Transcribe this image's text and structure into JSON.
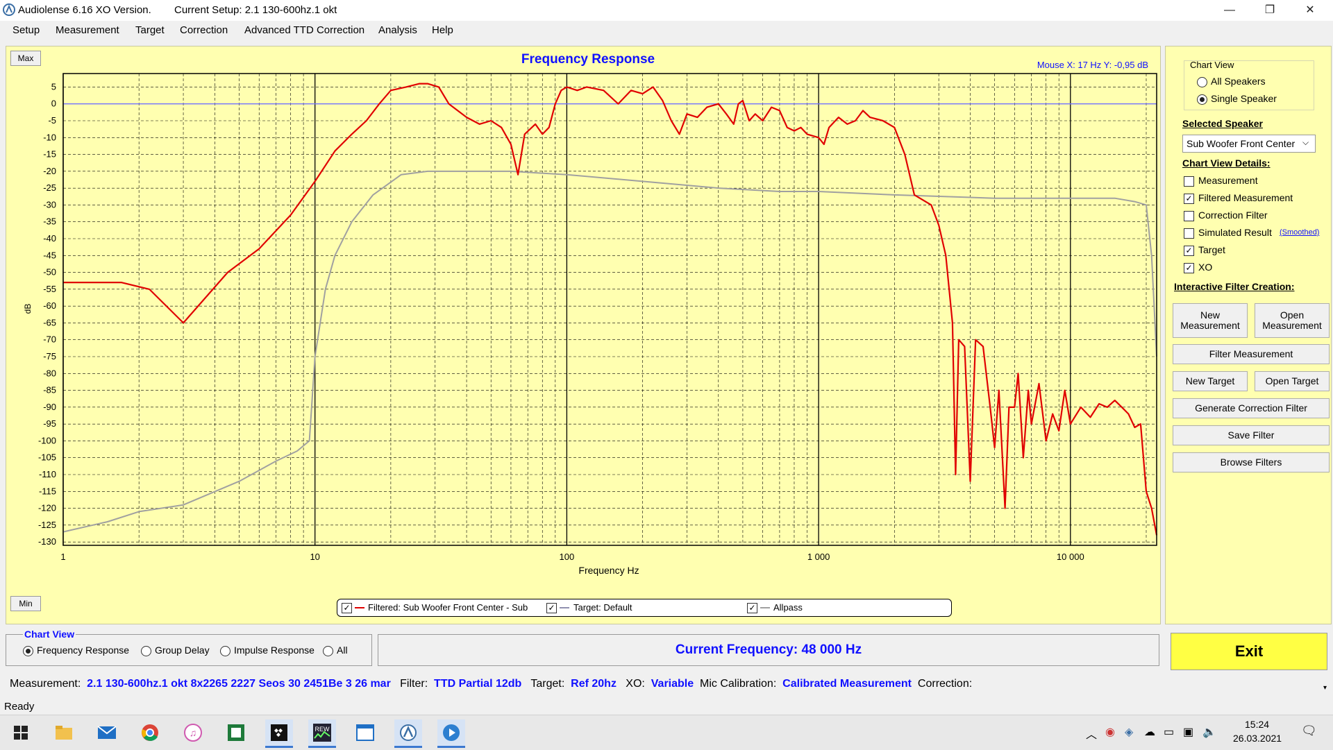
{
  "window": {
    "app_title": "Audiolense 6.16 XO Version.",
    "setup_title": "Current Setup: 2.1 130-600hz.1 okt",
    "minimize": "—",
    "maximize": "❐",
    "close": "✕"
  },
  "menu": [
    "Setup",
    "Measurement",
    "Target",
    "Correction",
    "Advanced TTD Correction",
    "Analysis",
    "Help"
  ],
  "chart": {
    "max_label": "Max",
    "min_label": "Min",
    "mouse_readout": "Mouse X: 17 Hz   Y: -0,95 dB",
    "legend": {
      "filtered": "Filtered: Sub Woofer Front Center - Sub",
      "target": "Target: Default",
      "allpass": "Allpass"
    }
  },
  "chart_data": {
    "type": "line",
    "title": "Frequency Response",
    "xlabel": "Frequency Hz",
    "ylabel": "dB",
    "xscale": "log",
    "xlim": [
      1,
      22000
    ],
    "ylim": [
      -131,
      9
    ],
    "xtick_labels": [
      {
        "x": 1,
        "label": "1"
      },
      {
        "x": 10,
        "label": "10"
      },
      {
        "x": 100,
        "label": "100"
      },
      {
        "x": 1000,
        "label": "1 000"
      },
      {
        "x": 10000,
        "label": "10 000"
      }
    ],
    "yticks": [
      5,
      0,
      -5,
      -10,
      -15,
      -20,
      -25,
      -30,
      -35,
      -40,
      -45,
      -50,
      -55,
      -60,
      -65,
      -70,
      -75,
      -80,
      -85,
      -90,
      -95,
      -100,
      -105,
      -110,
      -115,
      -120,
      -125,
      -130
    ],
    "grid": true,
    "colors": {
      "filtered": "#e00000",
      "target": "#7070ff",
      "allpass": "#a0a0a0",
      "background": "#ffffb0"
    },
    "series": [
      {
        "name": "Filtered: Sub Woofer Front Center - Sub",
        "points": [
          [
            1,
            -53
          ],
          [
            1.3,
            -53
          ],
          [
            1.7,
            -53
          ],
          [
            2.2,
            -55
          ],
          [
            3,
            -65
          ],
          [
            4.5,
            -50
          ],
          [
            6,
            -43
          ],
          [
            8,
            -33
          ],
          [
            10,
            -23
          ],
          [
            12,
            -14
          ],
          [
            14,
            -9
          ],
          [
            16,
            -5
          ],
          [
            18,
            0
          ],
          [
            20,
            4
          ],
          [
            23,
            5
          ],
          [
            26,
            6
          ],
          [
            28,
            6
          ],
          [
            31,
            5
          ],
          [
            34,
            0
          ],
          [
            40,
            -4
          ],
          [
            45,
            -6
          ],
          [
            50,
            -5
          ],
          [
            55,
            -7
          ],
          [
            60,
            -12
          ],
          [
            64,
            -21
          ],
          [
            68,
            -9
          ],
          [
            75,
            -6
          ],
          [
            80,
            -9
          ],
          [
            85,
            -7
          ],
          [
            90,
            0
          ],
          [
            95,
            4
          ],
          [
            100,
            5
          ],
          [
            110,
            4
          ],
          [
            120,
            5
          ],
          [
            140,
            4
          ],
          [
            160,
            0
          ],
          [
            180,
            4
          ],
          [
            200,
            3
          ],
          [
            220,
            5
          ],
          [
            240,
            1
          ],
          [
            260,
            -5
          ],
          [
            280,
            -9
          ],
          [
            300,
            -3
          ],
          [
            330,
            -4
          ],
          [
            360,
            -1
          ],
          [
            400,
            0
          ],
          [
            430,
            -3
          ],
          [
            460,
            -6
          ],
          [
            480,
            0
          ],
          [
            500,
            1
          ],
          [
            530,
            -5
          ],
          [
            560,
            -3
          ],
          [
            600,
            -5
          ],
          [
            650,
            -1
          ],
          [
            700,
            -2
          ],
          [
            750,
            -7
          ],
          [
            800,
            -8
          ],
          [
            850,
            -7
          ],
          [
            900,
            -9
          ],
          [
            1000,
            -10
          ],
          [
            1050,
            -12
          ],
          [
            1100,
            -7
          ],
          [
            1200,
            -4
          ],
          [
            1300,
            -6
          ],
          [
            1400,
            -5
          ],
          [
            1500,
            -2
          ],
          [
            1600,
            -4
          ],
          [
            1800,
            -5
          ],
          [
            2000,
            -7
          ],
          [
            2200,
            -15
          ],
          [
            2400,
            -27
          ],
          [
            2800,
            -30
          ],
          [
            3000,
            -36
          ],
          [
            3200,
            -45
          ],
          [
            3400,
            -65
          ],
          [
            3500,
            -110
          ],
          [
            3600,
            -70
          ],
          [
            3800,
            -72
          ],
          [
            4000,
            -112
          ],
          [
            4200,
            -70
          ],
          [
            4500,
            -72
          ],
          [
            4800,
            -90
          ],
          [
            5000,
            -102
          ],
          [
            5200,
            -85
          ],
          [
            5500,
            -120
          ],
          [
            5700,
            -90
          ],
          [
            6000,
            -90
          ],
          [
            6200,
            -80
          ],
          [
            6500,
            -105
          ],
          [
            6800,
            -85
          ],
          [
            7000,
            -95
          ],
          [
            7500,
            -83
          ],
          [
            8000,
            -100
          ],
          [
            8500,
            -92
          ],
          [
            9000,
            -97
          ],
          [
            9500,
            -85
          ],
          [
            10000,
            -95
          ],
          [
            11000,
            -90
          ],
          [
            12000,
            -93
          ],
          [
            13000,
            -89
          ],
          [
            14000,
            -90
          ],
          [
            15000,
            -88
          ],
          [
            16000,
            -90
          ],
          [
            17000,
            -92
          ],
          [
            18000,
            -96
          ],
          [
            19000,
            -95
          ],
          [
            20000,
            -115
          ],
          [
            21000,
            -120
          ],
          [
            22000,
            -128
          ]
        ]
      },
      {
        "name": "Target: Default",
        "points": [
          [
            1,
            0
          ],
          [
            22000,
            0
          ]
        ]
      },
      {
        "name": "Allpass",
        "points": [
          [
            1,
            -127
          ],
          [
            1.5,
            -124
          ],
          [
            2,
            -121
          ],
          [
            3,
            -119
          ],
          [
            5,
            -112
          ],
          [
            7,
            -106
          ],
          [
            8.5,
            -103
          ],
          [
            9.5,
            -100
          ],
          [
            10,
            -75
          ],
          [
            11,
            -55
          ],
          [
            12,
            -45
          ],
          [
            14,
            -35
          ],
          [
            17,
            -27
          ],
          [
            22,
            -21
          ],
          [
            28,
            -20
          ],
          [
            40,
            -20
          ],
          [
            60,
            -20
          ],
          [
            100,
            -21
          ],
          [
            200,
            -23
          ],
          [
            400,
            -25
          ],
          [
            700,
            -26
          ],
          [
            1000,
            -26
          ],
          [
            2000,
            -27
          ],
          [
            5000,
            -28
          ],
          [
            10000,
            -28
          ],
          [
            15000,
            -28
          ],
          [
            18000,
            -29
          ],
          [
            20000,
            -30
          ],
          [
            21000,
            -45
          ],
          [
            22000,
            -75
          ]
        ]
      }
    ]
  },
  "right_panel": {
    "chart_view_title": "Chart View",
    "all_speakers": "All Speakers",
    "single_speaker": "Single Speaker",
    "selected_speaker_title": "Selected Speaker",
    "selected_speaker_value": "Sub Woofer Front Center",
    "details_title": "Chart View Details:",
    "details": [
      {
        "label": "Measurement",
        "checked": false
      },
      {
        "label": "Filtered Measurement",
        "checked": true
      },
      {
        "label": "Correction Filter",
        "checked": false
      },
      {
        "label": "Simulated Result",
        "checked": false
      },
      {
        "label": "Target",
        "checked": true
      },
      {
        "label": "XO",
        "checked": true
      }
    ],
    "smoothed": "(Smoothed)",
    "interactive_title": "Interactive Filter Creation:",
    "new_measurement": "New Measurement",
    "open_measurement": "Open Measurement",
    "filter_measurement": "Filter Measurement",
    "new_target": "New Target",
    "open_target": "Open Target",
    "generate_correction_filter": "Generate Correction Filter",
    "save_filter": "Save Filter",
    "browse_filters": "Browse Filters"
  },
  "bottom": {
    "chart_view_title": "Chart View",
    "options": [
      "Frequency Response",
      "Group Delay",
      "Impulse Response",
      "All"
    ],
    "current_frequency": "Current Frequency: 48 000 Hz",
    "exit": "Exit"
  },
  "info": {
    "measurement_label": "Measurement:",
    "measurement_value": "2.1 130-600hz.1 okt 8x2265 2227 Seos 30 2451Be 3 26 mar",
    "filter_label": "Filter:",
    "filter_value": "TTD Partial 12db",
    "target_label": "Target:",
    "target_value": "Ref 20hz",
    "xo_label": "XO:",
    "xo_value": "Variable",
    "mic_label": "Mic Calibration:",
    "mic_value": "Calibrated Measurement",
    "correction_label": "Correction:"
  },
  "status": "Ready",
  "taskbar": {
    "time": "15:24",
    "date": "26.03.2021",
    "icons": [
      "windows-start",
      "file-explorer",
      "mail",
      "chrome",
      "itunes",
      "excel-like",
      "tidal",
      "rew",
      "window-app",
      "audiolense",
      "media-player"
    ]
  }
}
